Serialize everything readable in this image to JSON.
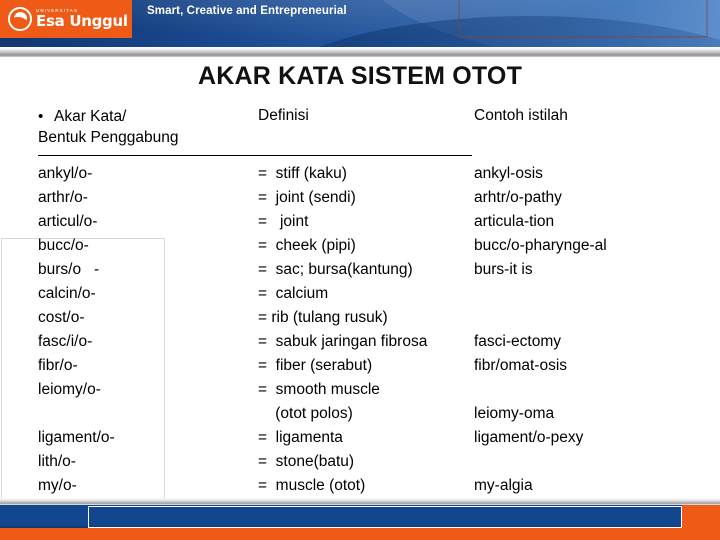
{
  "header": {
    "logo": {
      "superscript": "UNIVERSITAS",
      "name": "Esa Unggul",
      "mark_icon": "esa-unggul-circle-logo"
    },
    "tagline": "Smart, Creative and Entrepreneurial"
  },
  "title": "AKAR KATA SISTEM OTOT",
  "table": {
    "bullet": "•",
    "headers": {
      "term_line1": "Akar Kata/",
      "term_line2": "Bentuk Penggabung",
      "definition": "Definisi",
      "example": "Contoh istilah"
    },
    "rows": [
      {
        "term": "ankyl/o-",
        "definition": "=  stiff (kaku)",
        "example": "ankyl-osis"
      },
      {
        "term": "arthr/o-",
        "definition": "=  joint (sendi)",
        "example": "arhtr/o-pathy"
      },
      {
        "term": "articul/o-",
        "definition": "=   joint",
        "example": "articula-tion"
      },
      {
        "term": "bucc/o-",
        "definition": "=  cheek (pipi)",
        "example": "bucc/o-pharynge-al"
      },
      {
        "term": "burs/o   -",
        "definition": "=  sac; bursa(kantung)",
        "example": "burs-it is"
      },
      {
        "term": "calcin/o-",
        "definition": "=  calcium",
        "example": ""
      },
      {
        "term": "cost/o-",
        "definition": "= rib (tulang rusuk)",
        "example": ""
      },
      {
        "term": "fasc/i/o-",
        "definition": "=  sabuk jaringan fibrosa",
        "example": "fasci-ectomy"
      },
      {
        "term": "fibr/o-",
        "definition": "=  fiber (serabut)",
        "example": "fibr/omat-osis"
      },
      {
        "term": "leiomy/o-",
        "definition": "=  smooth muscle",
        "example": ""
      },
      {
        "term": "",
        "definition": "    (otot polos)",
        "example": "leiomy-oma"
      },
      {
        "term": "ligament/o-",
        "definition": "=  ligamenta",
        "example": "ligament/o-pexy"
      },
      {
        "term": "lith/o-",
        "definition": "=  stone(batu)",
        "example": ""
      },
      {
        "term": "my/o-",
        "definition": "=  muscle (otot)",
        "example": "my-algia"
      }
    ]
  },
  "colors": {
    "brand_orange": "#ef5b16",
    "brand_blue": "#12468f",
    "header_blue_dark": "#0f3673",
    "header_blue_light": "#5a8ccb"
  }
}
